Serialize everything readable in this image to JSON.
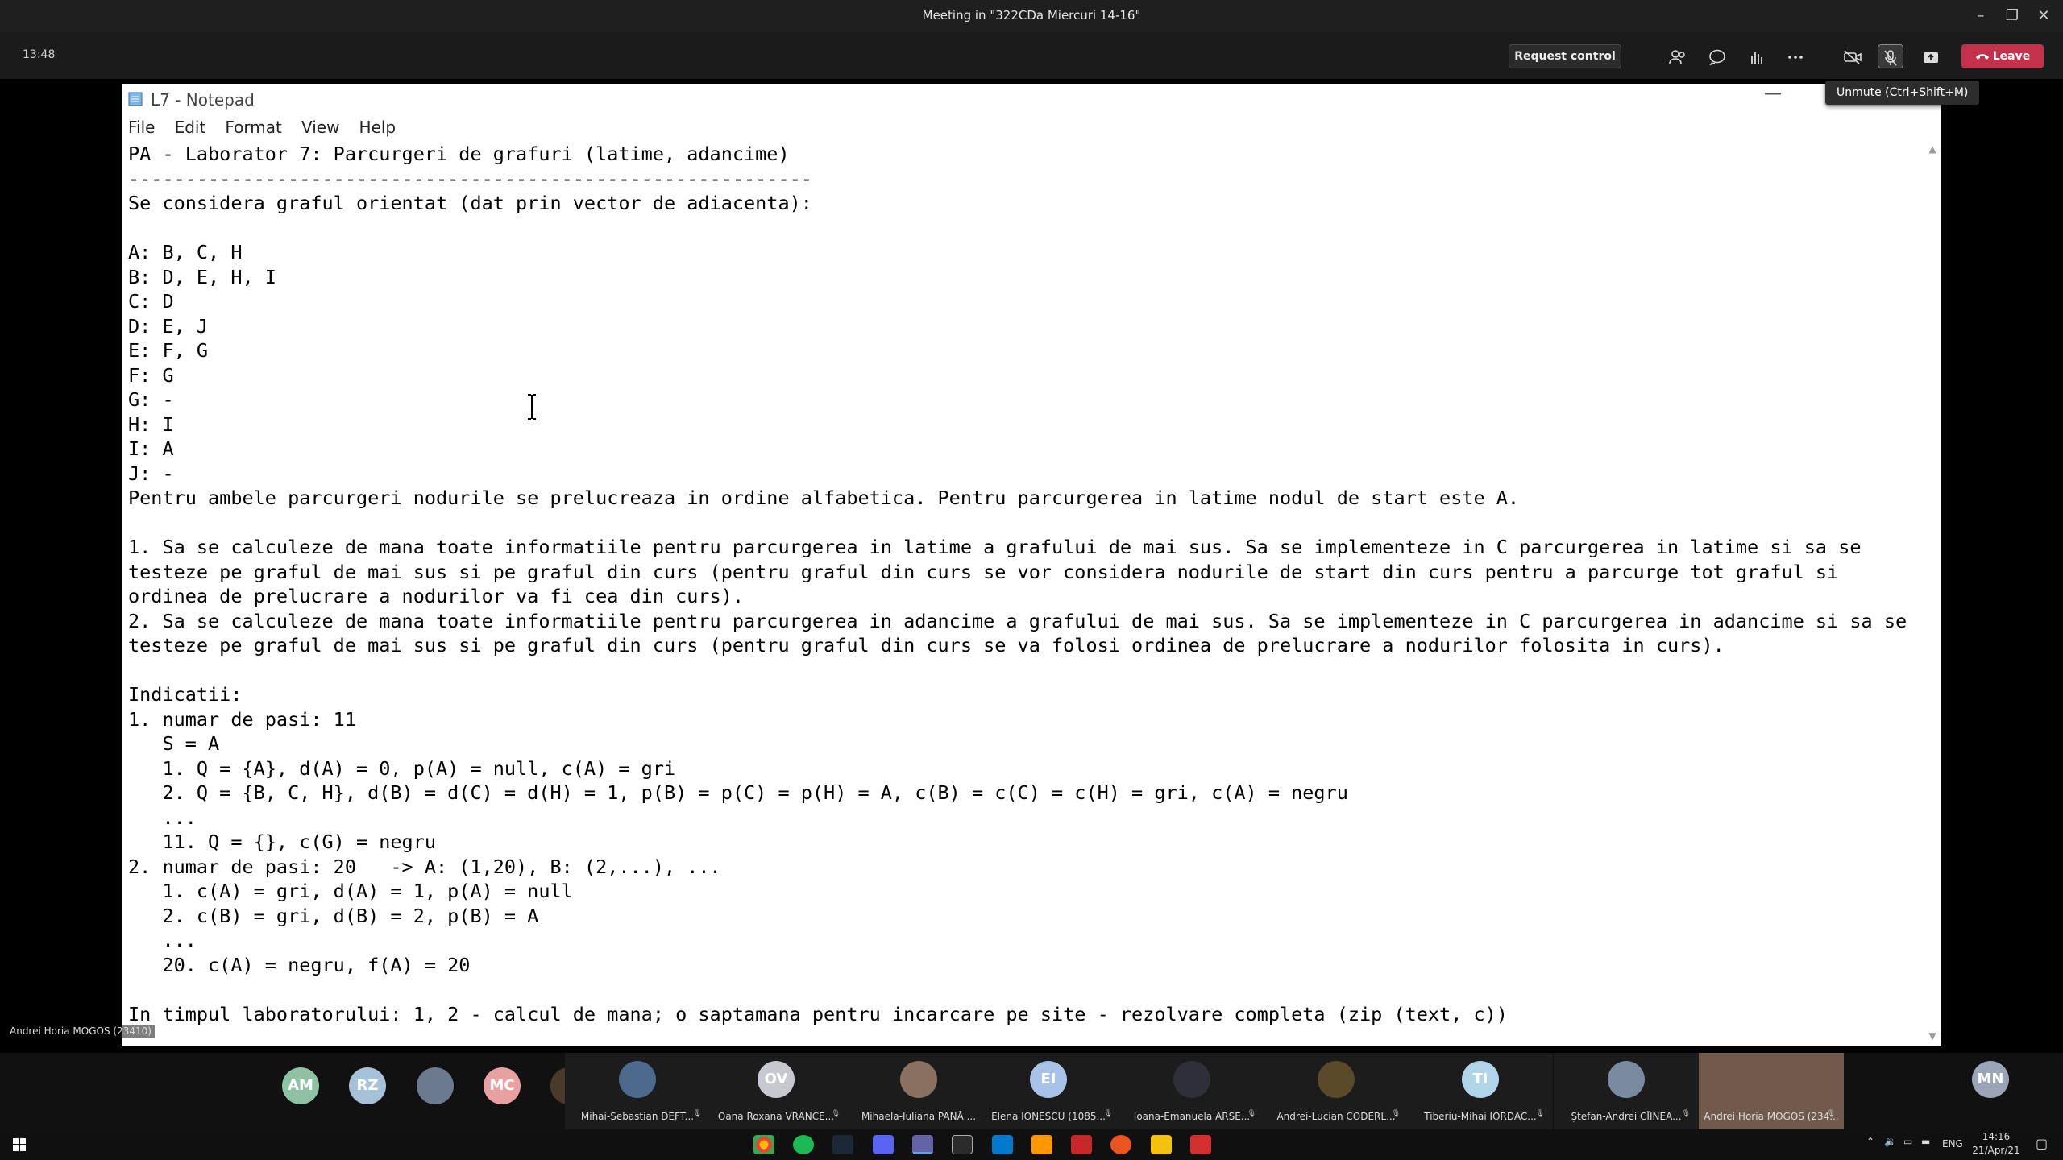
{
  "teams": {
    "window_title": "Meeting in \"322CDa Miercuri 14-16\"",
    "meeting_time": "13:48",
    "request_control_label": "Request control",
    "leave_label": "Leave",
    "unmute_tooltip": "Unmute (Ctrl+Shift+M)",
    "presenter_label": "Andrei Horia MOGOS (23410)"
  },
  "notepad": {
    "title": "L7 - Notepad",
    "menu": [
      "File",
      "Edit",
      "Format",
      "View",
      "Help"
    ],
    "lines": [
      "PA - Laborator 7: Parcurgeri de grafuri (latime, adancime)",
      "------------------------------------------------------------",
      "Se considera graful orientat (dat prin vector de adiacenta):",
      "",
      "A: B, C, H",
      "B: D, E, H, I",
      "C: D",
      "D: E, J",
      "E: F, G",
      "F: G",
      "G: -",
      "H: I",
      "I: A",
      "J: -",
      "Pentru ambele parcurgeri nodurile se prelucreaza in ordine alfabetica. Pentru parcurgerea in latime nodul de start este A.",
      "",
      "1. Sa se calculeze de mana toate informatiile pentru parcurgerea in latime a grafului de mai sus. Sa se implementeze in C parcurgerea in latime si sa se",
      "testeze pe graful de mai sus si pe graful din curs (pentru graful din curs se vor considera nodurile de start din curs pentru a parcurge tot graful si",
      "ordinea de prelucrare a nodurilor va fi cea din curs).",
      "2. Sa se calculeze de mana toate informatiile pentru parcurgerea in adancime a grafului de mai sus. Sa se implementeze in C parcurgerea in adancime si sa se",
      "testeze pe graful de mai sus si pe graful din curs (pentru graful din curs se va folosi ordinea de prelucrare a nodurilor folosita in curs).",
      "",
      "Indicatii:",
      "1. numar de pasi: 11",
      "   S = A",
      "   1. Q = {A}, d(A) = 0, p(A) = null, c(A) = gri",
      "   2. Q = {B, C, H}, d(B) = d(C) = d(H) = 1, p(B) = p(C) = p(H) = A, c(B) = c(C) = c(H) = gri, c(A) = negru",
      "   ...",
      "   11. Q = {}, c(G) = negru",
      "2. numar de pasi: 20   -> A: (1,20), B: (2,...), ...",
      "   1. c(A) = gri, d(A) = 1, p(A) = null",
      "   2. c(B) = gri, d(B) = 2, p(B) = A",
      "   ...",
      "   20. c(A) = negru, f(A) = 20",
      "",
      "In timpul laboratorului: 1, 2 - calcul de mana; o saptamana pentru incarcare pe site - rezolvare completa (zip (text, c))"
    ]
  },
  "participants": [
    {
      "initials": "AM",
      "name": "",
      "color": "#8fc2a3"
    },
    {
      "initials": "RZ",
      "name": "",
      "color": "#a7c1d9"
    },
    {
      "initials": "",
      "name": "",
      "color": "#6b7a8f"
    },
    {
      "initials": "MC",
      "name": "",
      "color": "#e8a0a0"
    },
    {
      "initials": "",
      "name": "",
      "color": "#4a3a2a"
    },
    {
      "initials": "",
      "name": "Mihai-Sebastian DEFT...",
      "color": "#4c6a8c"
    },
    {
      "initials": "OV",
      "name": "Oana Roxana VRANCE...",
      "color": "#c8c8d0"
    },
    {
      "initials": "",
      "name": "Mihaela-Iuliana PANĂ ...",
      "color": "#8a7060"
    },
    {
      "initials": "EI",
      "name": "Elena IONESCU (1085...",
      "color": "#a9c2e8"
    },
    {
      "initials": "",
      "name": "Ioana-Emanuela ARSE...",
      "color": "#2f2f3a"
    },
    {
      "initials": "",
      "name": "Andrei-Lucian CODERL...",
      "color": "#5a4a2a"
    },
    {
      "initials": "TI",
      "name": "Tiberiu-Mihai IORDAC...",
      "color": "#b0d4e8"
    },
    {
      "initials": "",
      "name": "Ștefan-Andrei CÎINEA...",
      "color": "#7a8aa0"
    },
    {
      "initials": "",
      "name": "Andrei Horia MOGOS (234...",
      "color": "#6f5a4c"
    },
    {
      "initials": "MN",
      "name": "",
      "color": "#9aa5b8"
    }
  ],
  "taskbar": {
    "language": "ENG",
    "time": "14:16",
    "date": "21/Apr/21"
  },
  "icons": {
    "video": "video-off-icon",
    "mic": "mic-off-icon",
    "share": "share-tray-icon",
    "leave": "phone-hangup-icon"
  }
}
